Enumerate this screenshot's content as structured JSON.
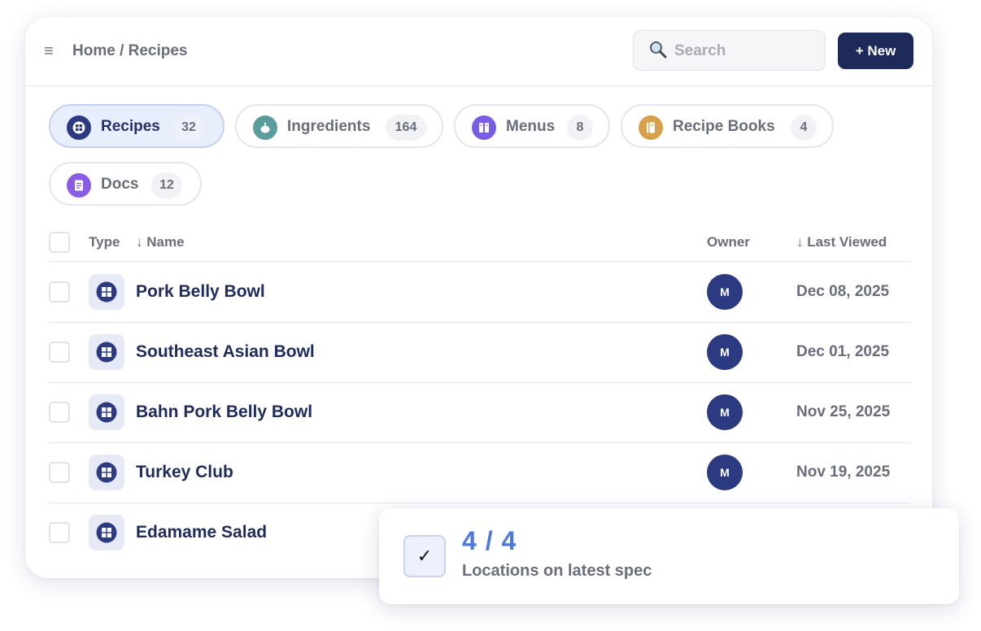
{
  "header": {
    "breadcrumb": "Home / Recipes",
    "search_placeholder": "Search",
    "new_button": "+ New"
  },
  "tabs": [
    {
      "label": "Recipes",
      "count": "32",
      "icon": "recipe-grid-icon",
      "color": "#2c3a82",
      "active": true
    },
    {
      "label": "Ingredients",
      "count": "164",
      "icon": "ingredient-icon",
      "color": "#5b9d9c",
      "active": false
    },
    {
      "label": "Menus",
      "count": "8",
      "icon": "menu-icon",
      "color": "#7b5ce6",
      "active": false
    },
    {
      "label": "Recipe Books",
      "count": "4",
      "icon": "recipe-book-icon",
      "color": "#d9a04a",
      "active": false
    },
    {
      "label": "Docs",
      "count": "12",
      "icon": "document-icon",
      "color": "#8a5ce6",
      "active": false
    }
  ],
  "table": {
    "columns": {
      "type": "Type",
      "name": "↓ Name",
      "owner": "Owner",
      "last_viewed": "↓ Last Viewed"
    },
    "rows": [
      {
        "name": "Pork Belly Bowl",
        "owner": "M",
        "last_viewed": "Dec 08, 2025"
      },
      {
        "name": "Southeast Asian Bowl",
        "owner": "M",
        "last_viewed": "Dec 01, 2025"
      },
      {
        "name": "Bahn Pork Belly Bowl",
        "owner": "M",
        "last_viewed": "Nov 25, 2025"
      },
      {
        "name": "Turkey Club",
        "owner": "M",
        "last_viewed": "Nov 19, 2025"
      },
      {
        "name": "Edamame Salad",
        "owner": "",
        "last_viewed": ""
      }
    ]
  },
  "popup": {
    "check": "✓",
    "value": "4 / 4",
    "label": "Locations on latest spec"
  },
  "colors": {
    "primary": "#1e2a5a",
    "accent": "#4d78dc",
    "avatar": "#2c3a82"
  }
}
